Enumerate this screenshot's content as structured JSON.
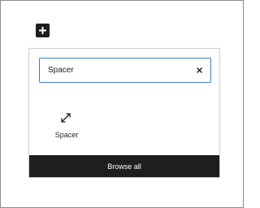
{
  "toolbar": {
    "add_icon": "plus-icon"
  },
  "inserter": {
    "search": {
      "value": "Spacer",
      "placeholder": "",
      "clear_icon": "close-icon"
    },
    "results": [
      {
        "label": "Spacer",
        "icon": "resize-icon"
      }
    ],
    "browse_all_label": "Browse all"
  },
  "colors": {
    "accent": "#3f7bc1",
    "dark": "#1e1e1e",
    "border": "#cfcfcf"
  }
}
